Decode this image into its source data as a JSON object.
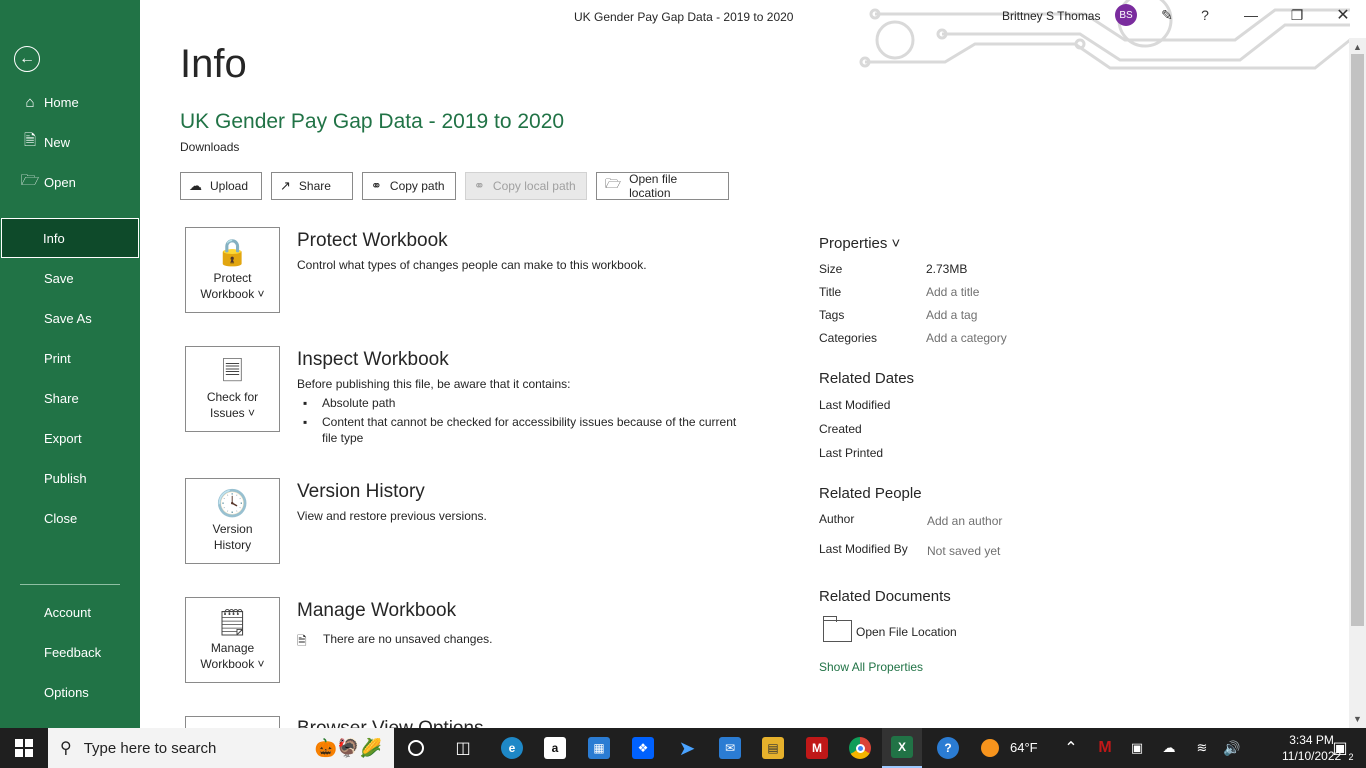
{
  "titlebar": {
    "title": "UK Gender Pay Gap Data - 2019 to 2020",
    "user_name": "Brittney S Thomas",
    "avatar_initials": "BS",
    "help": "?"
  },
  "sidebar": {
    "items": [
      {
        "label": "Home",
        "icon": "home-icon"
      },
      {
        "label": "New",
        "icon": "new-document-icon"
      },
      {
        "label": "Open",
        "icon": "folder-open-icon"
      },
      {
        "label": "Info",
        "active": true
      },
      {
        "label": "Save"
      },
      {
        "label": "Save As"
      },
      {
        "label": "Print"
      },
      {
        "label": "Share"
      },
      {
        "label": "Export"
      },
      {
        "label": "Publish"
      },
      {
        "label": "Close"
      },
      {
        "label": "Account"
      },
      {
        "label": "Feedback"
      },
      {
        "label": "Options"
      }
    ]
  },
  "main": {
    "page_title": "Info",
    "doc_title": "UK Gender Pay Gap Data - 2019 to 2020",
    "doc_location": "Downloads",
    "actions": [
      {
        "label": "Upload"
      },
      {
        "label": "Share"
      },
      {
        "label": "Copy path"
      },
      {
        "label": "Copy local path",
        "disabled": true
      },
      {
        "label": "Open file location"
      }
    ],
    "sections": {
      "protect": {
        "button_line1": "Protect",
        "button_line2": "Workbook ˅",
        "title": "Protect Workbook",
        "desc": "Control what types of changes people can make to this workbook."
      },
      "inspect": {
        "button_line1": "Check for",
        "button_line2": "Issues ˅",
        "title": "Inspect Workbook",
        "desc": "Before publishing this file, be aware that it contains:",
        "bullets": [
          "Absolute path",
          "Content that cannot be checked for accessibility issues because of the current file type"
        ]
      },
      "version": {
        "button_line1": "Version",
        "button_line2": "History",
        "title": "Version History",
        "desc": "View and restore previous versions."
      },
      "manage": {
        "button_line1": "Manage",
        "button_line2": "Workbook ˅",
        "title": "Manage Workbook",
        "desc": "There are no unsaved changes."
      },
      "browser": {
        "title": "Browser View Options"
      }
    }
  },
  "properties": {
    "heading": "Properties ˅",
    "size_label": "Size",
    "size_value": "2.73MB",
    "title_label": "Title",
    "title_value": "Add a title",
    "tags_label": "Tags",
    "tags_value": "Add a tag",
    "categories_label": "Categories",
    "categories_value": "Add a category",
    "related_dates": "Related Dates",
    "last_modified": "Last Modified",
    "created": "Created",
    "last_printed": "Last Printed",
    "related_people": "Related People",
    "author_label": "Author",
    "author_value": "Add an author",
    "last_modified_by_label": "Last Modified By",
    "last_modified_by_value": "Not saved yet",
    "related_documents": "Related Documents",
    "open_file_location": "Open File Location",
    "show_all": "Show All Properties"
  },
  "taskbar": {
    "search_placeholder": "Type here to search",
    "weather": "64°F",
    "time": "3:34 PM",
    "date": "11/10/2022",
    "notification_count": "2"
  },
  "colors": {
    "brand": "#217346",
    "active_nav": "#0e4a2a",
    "taskbar": "#1f1f1f"
  }
}
